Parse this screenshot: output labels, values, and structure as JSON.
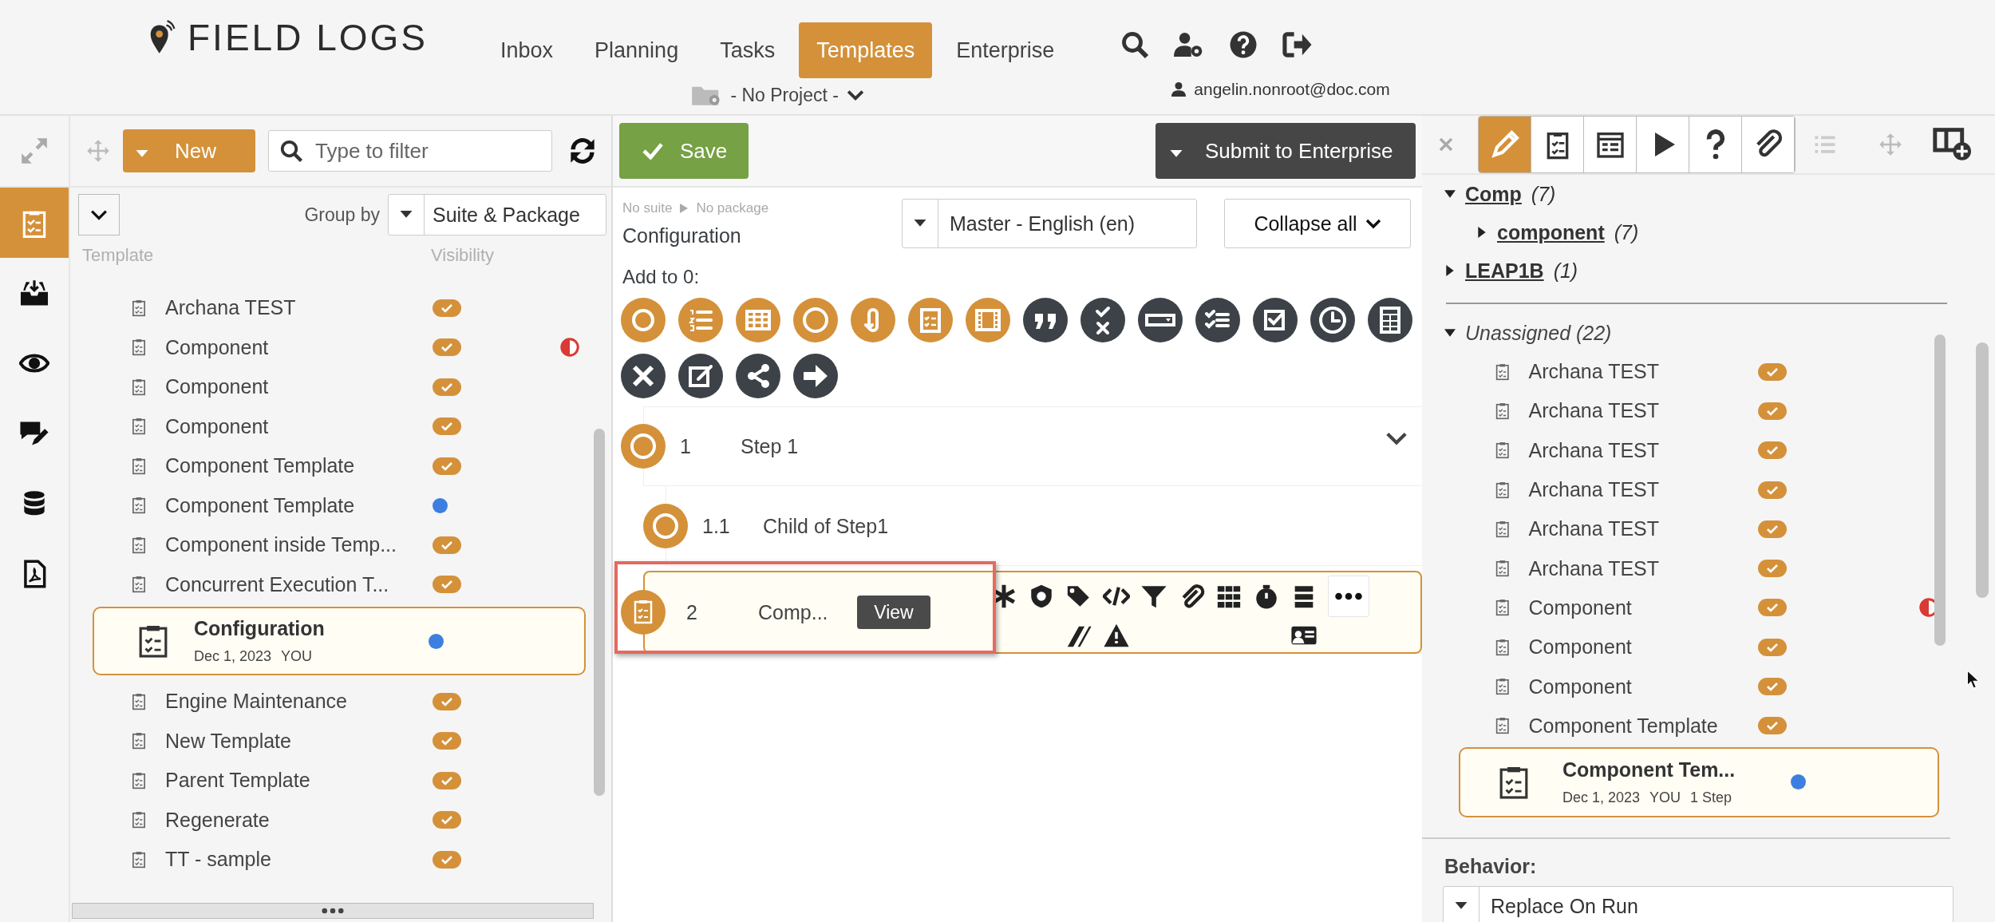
{
  "header": {
    "logo": "FIELD LOGS",
    "nav": [
      {
        "label": "Inbox",
        "selected": false
      },
      {
        "label": "Planning",
        "selected": false
      },
      {
        "label": "Tasks",
        "selected": false
      },
      {
        "label": "Templates",
        "selected": true
      },
      {
        "label": "Enterprise",
        "selected": false
      }
    ],
    "project": "- No Project -",
    "user": "angelin.nonroot@doc.com"
  },
  "left": {
    "new_button": "New",
    "filter_placeholder": "Type to filter",
    "group_by_label": "Group by",
    "group_by_value": "Suite & Package",
    "columns": [
      "Template",
      "Visibility"
    ],
    "items": [
      {
        "name": "Archana TEST",
        "published": true,
        "warning": false,
        "selected": false
      },
      {
        "name": "Component",
        "published": true,
        "warning": true,
        "selected": false
      },
      {
        "name": "Component",
        "published": true,
        "warning": false,
        "selected": false
      },
      {
        "name": "Component",
        "published": true,
        "warning": false,
        "selected": false
      },
      {
        "name": "Component Template",
        "published": true,
        "warning": false,
        "selected": false
      },
      {
        "name": "Component Template",
        "published": false,
        "warning": false,
        "selected": false
      },
      {
        "name": "Component inside Temp...",
        "published": true,
        "warning": false,
        "selected": false
      },
      {
        "name": "Concurrent Execution T...",
        "published": true,
        "warning": false,
        "selected": false
      },
      {
        "name": "Configuration",
        "published": false,
        "warning": false,
        "selected": true,
        "date": "Dec 1, 2023",
        "owner": "YOU"
      },
      {
        "name": "Engine Maintenance",
        "published": true,
        "warning": false,
        "selected": false
      },
      {
        "name": "New Template",
        "published": true,
        "warning": false,
        "selected": false
      },
      {
        "name": "Parent Template",
        "published": true,
        "warning": false,
        "selected": false
      },
      {
        "name": "Regenerate",
        "published": true,
        "warning": false,
        "selected": false
      },
      {
        "name": "TT - sample",
        "published": true,
        "warning": false,
        "selected": false
      }
    ]
  },
  "editor": {
    "save": "Save",
    "submit": "Submit to Enterprise",
    "suite": "No suite",
    "package": "No package",
    "title": "Configuration",
    "language": "Master - English (en)",
    "collapse": "Collapse all",
    "add_to": "Add to 0:",
    "steps": [
      {
        "number": "1",
        "title": "Step 1",
        "kind": "step",
        "selected": false,
        "children": [
          {
            "number": "1.1",
            "title": "Child of Step1",
            "kind": "step",
            "selected": false
          }
        ]
      },
      {
        "number": "2",
        "title": "Comp...",
        "kind": "component",
        "selected": true,
        "action": "View"
      }
    ]
  },
  "right": {
    "tabs": [
      {
        "selected": true
      },
      {
        "selected": false
      },
      {
        "selected": false
      },
      {
        "selected": false
      },
      {
        "selected": false
      },
      {
        "selected": false
      }
    ],
    "tree": [
      {
        "label": "Comp",
        "count": "(7)",
        "expanded": true,
        "children": [
          {
            "label": "component",
            "count": "(7)",
            "expanded": false
          }
        ]
      },
      {
        "label": "LEAP1B",
        "count": "(1)",
        "expanded": false
      }
    ],
    "unassigned": {
      "label": "Unassigned (22)",
      "expanded": true
    },
    "items": [
      {
        "name": "Archana TEST",
        "published": true,
        "warning": false,
        "selected": false
      },
      {
        "name": "Archana TEST",
        "published": true,
        "warning": false,
        "selected": false
      },
      {
        "name": "Archana TEST",
        "published": true,
        "warning": false,
        "selected": false
      },
      {
        "name": "Archana TEST",
        "published": true,
        "warning": false,
        "selected": false
      },
      {
        "name": "Archana TEST",
        "published": true,
        "warning": false,
        "selected": false
      },
      {
        "name": "Archana TEST",
        "published": true,
        "warning": false,
        "selected": false
      },
      {
        "name": "Component",
        "published": true,
        "warning": true,
        "selected": false
      },
      {
        "name": "Component",
        "published": true,
        "warning": false,
        "selected": false
      },
      {
        "name": "Component",
        "published": true,
        "warning": false,
        "selected": false
      },
      {
        "name": "Component Template",
        "published": true,
        "warning": false,
        "selected": false
      },
      {
        "name": "Component Tem...",
        "published": false,
        "warning": false,
        "selected": true,
        "date": "Dec 1, 2023",
        "owner": "YOU",
        "steps": "1 Step"
      }
    ],
    "behavior_label": "Behavior:",
    "behavior_value": "Replace On Run"
  }
}
